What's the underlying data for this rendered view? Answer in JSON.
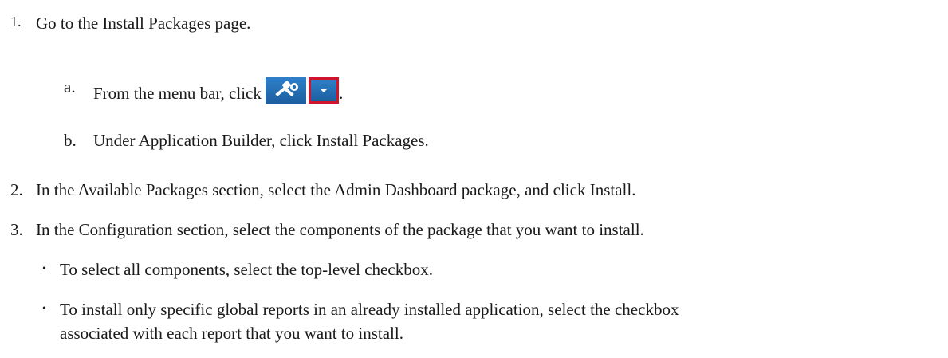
{
  "steps": [
    {
      "number": "1.",
      "text": "Go to the Install Packages page.",
      "substeps": [
        {
          "letter": "a.",
          "text_before": "From the menu bar, click",
          "text_after": "."
        },
        {
          "letter": "b.",
          "text": "Under Application Builder, click Install Packages."
        }
      ]
    },
    {
      "number": "2.",
      "text": "In the Available Packages section, select the Admin Dashboard package, and click Install."
    },
    {
      "number": "3.",
      "text": "In the Configuration section, select the components of the package that you want to install.",
      "bullets": [
        {
          "symbol": "•",
          "lines": [
            "To select all components, select the top-level checkbox."
          ]
        },
        {
          "symbol": "•",
          "lines": [
            "To install only specific global reports in an already installed application, select the checkbox",
            "associated with each report that you want to install."
          ]
        }
      ]
    }
  ],
  "icons": {
    "tools_button": "tools-icon",
    "dropdown_button": "caret-down-icon"
  }
}
